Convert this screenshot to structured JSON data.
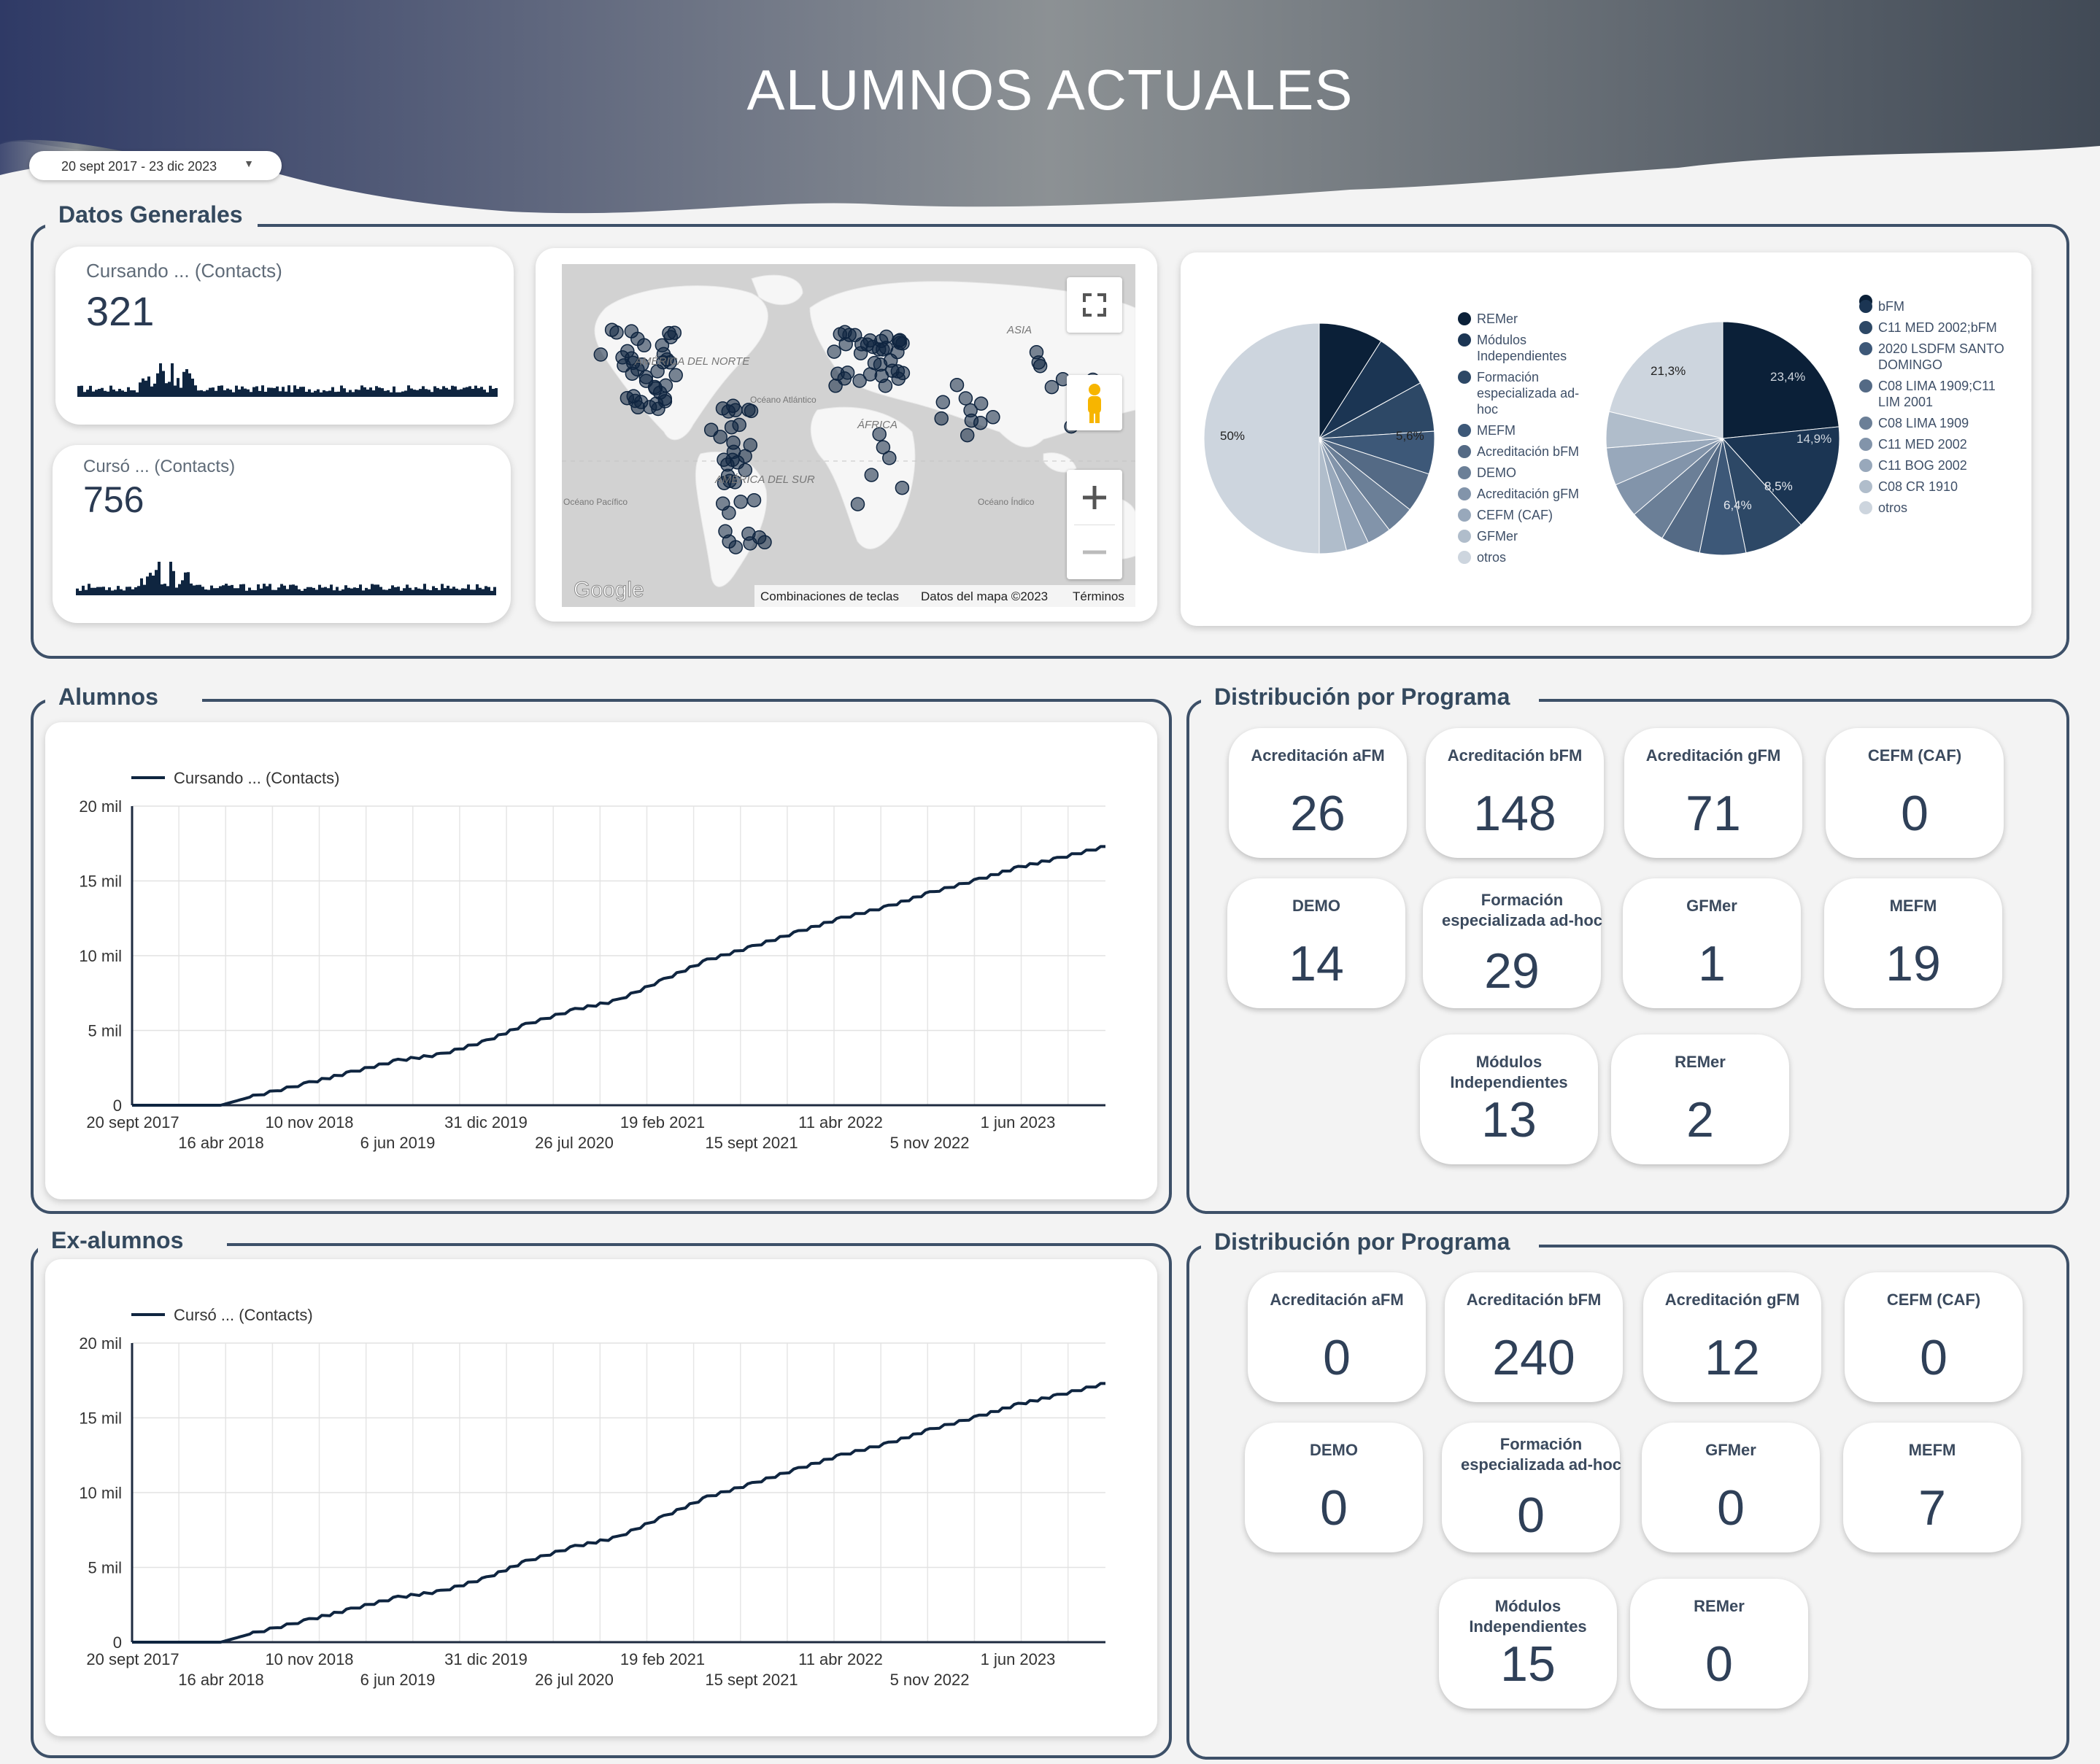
{
  "header": {
    "title": "ALUMNOS ACTUALES"
  },
  "date_range": {
    "label": "20 sept 2017 - 23 dic 2023"
  },
  "datos_generales": {
    "title": "Datos Generales",
    "kpi_cursando": {
      "label": "Cursando ... (Contacts)",
      "value": "321"
    },
    "kpi_curso": {
      "label": "Cursó ... (Contacts)",
      "value": "756"
    },
    "map": {
      "labels": {
        "america_norte": "AMÉRICA DEL NORTE",
        "asia": "ASIA",
        "africa": "ÁFRICA",
        "america_sur": "AMÉRICA DEL SUR",
        "oceano_atlantico": "Océano Atlántico",
        "oceano_pacifico": "Océano Pacífico",
        "oceano_indico": "Océano Índico"
      },
      "google": "Google",
      "footer": {
        "shortcuts": "Combinaciones de teclas",
        "data": "Datos del mapa ©2023",
        "terms": "Términos"
      }
    },
    "pie1": {
      "legend": [
        "REMer",
        "Módulos Independientes",
        "Formación especializada ad-hoc",
        "MEFM",
        "Acreditación bFM",
        "DEMO",
        "Acreditación gFM",
        "CEFM (CAF)",
        "GFMer",
        "otros"
      ],
      "label_big": "50%",
      "label_small": "5,6%"
    },
    "pie2": {
      "legend": [
        "",
        "bFM",
        "C11 MED 2002;bFM",
        "2020 LSDFM SANTO DOMINGO",
        "C08 LIMA 1909;C11 LIM 2001",
        "C08 LIMA 1909",
        "C11 MED 2002",
        "C11 BOG 2002",
        "C08 CR 1910",
        "otros"
      ],
      "labels": [
        "21,3%",
        "23,4%",
        "14,9%",
        "8,5%",
        "6,4%"
      ]
    }
  },
  "alumnos": {
    "title": "Alumnos",
    "chart_data": {
      "type": "line",
      "series": [
        {
          "name": "Cursando ... (Contacts)",
          "x": [
            "2017-09-20",
            "2018-04-16",
            "2018-07-01",
            "2018-11-10",
            "2019-02-15",
            "2019-06-06",
            "2019-09-15",
            "2019-12-31",
            "2020-04-01",
            "2020-07-26",
            "2020-11-01",
            "2021-02-19",
            "2021-06-01",
            "2021-09-15",
            "2022-01-01",
            "2022-04-11",
            "2022-08-01",
            "2022-11-05",
            "2023-03-01",
            "2023-06-01",
            "2023-09-01",
            "2023-12-23"
          ],
          "y": [
            0,
            0,
            600,
            1500,
            2200,
            3000,
            3400,
            4300,
            5400,
            6400,
            7000,
            8400,
            9700,
            10600,
            11600,
            12500,
            13300,
            14200,
            15100,
            15900,
            16500,
            17300
          ]
        }
      ],
      "ylabel": "",
      "xlabel": "",
      "ylim": [
        0,
        20000
      ],
      "yticks": [
        "20 mil",
        "15 mil",
        "10 mil",
        "5 mil",
        "0"
      ],
      "xticks_top": [
        "20 sept 2017",
        "10 nov 2018",
        "31 dic 2019",
        "19 feb 2021",
        "11 abr 2022",
        "1 jun 2023"
      ],
      "xticks_bottom": [
        "16 abr 2018",
        "6 jun 2019",
        "26 jul 2020",
        "15 sept 2021",
        "5 nov 2022"
      ],
      "grid": true,
      "legend": "top-left"
    }
  },
  "exalumnos": {
    "title": "Ex-alumnos",
    "chart_data": {
      "type": "line",
      "series": [
        {
          "name": "Cursó ... (Contacts)",
          "x": [
            "2017-09-20",
            "2018-04-16",
            "2018-07-01",
            "2018-11-10",
            "2019-02-15",
            "2019-06-06",
            "2019-09-15",
            "2019-12-31",
            "2020-04-01",
            "2020-07-26",
            "2020-11-01",
            "2021-02-19",
            "2021-06-01",
            "2021-09-15",
            "2022-01-01",
            "2022-04-11",
            "2022-08-01",
            "2022-11-05",
            "2023-03-01",
            "2023-06-01",
            "2023-09-01",
            "2023-12-23"
          ],
          "y": [
            0,
            0,
            600,
            1500,
            2200,
            3000,
            3400,
            4300,
            5400,
            6400,
            7000,
            8400,
            9700,
            10600,
            11600,
            12500,
            13300,
            14200,
            15100,
            15900,
            16500,
            17300
          ]
        }
      ],
      "ylabel": "",
      "xlabel": "",
      "ylim": [
        0,
        20000
      ],
      "yticks": [
        "20 mil",
        "15 mil",
        "10 mil",
        "5 mil",
        "0"
      ],
      "xticks_top": [
        "20 sept 2017",
        "10 nov 2018",
        "31 dic 2019",
        "19 feb 2021",
        "11 abr 2022",
        "1 jun 2023"
      ],
      "xticks_bottom": [
        "16 abr 2018",
        "6 jun 2019",
        "26 jul 2020",
        "15 sept 2021",
        "5 nov 2022"
      ],
      "grid": true,
      "legend": "top-left"
    }
  },
  "dist1": {
    "title": "Distribución por Programa",
    "cards": [
      {
        "label": "Acreditación aFM",
        "value": "26"
      },
      {
        "label": "Acreditación bFM",
        "value": "148"
      },
      {
        "label": "Acreditación gFM",
        "value": "71"
      },
      {
        "label": "CEFM (CAF)",
        "value": "0"
      },
      {
        "label": "DEMO",
        "value": "14"
      },
      {
        "label": "Formación especializada ad-hoc",
        "value": "29"
      },
      {
        "label": "GFMer",
        "value": "1"
      },
      {
        "label": "MEFM",
        "value": "19"
      },
      {
        "label": "Módulos Independientes",
        "value": "13"
      },
      {
        "label": "REMer",
        "value": "2"
      }
    ]
  },
  "dist2": {
    "title": "Distribución por Programa",
    "cards": [
      {
        "label": "Acreditación aFM",
        "value": "0"
      },
      {
        "label": "Acreditación bFM",
        "value": "240"
      },
      {
        "label": "Acreditación gFM",
        "value": "12"
      },
      {
        "label": "CEFM (CAF)",
        "value": "0"
      },
      {
        "label": "DEMO",
        "value": "0"
      },
      {
        "label": "Formación especializada ad-hoc",
        "value": "0"
      },
      {
        "label": "GFMer",
        "value": "0"
      },
      {
        "label": "MEFM",
        "value": "7"
      },
      {
        "label": "Módulos Independientes",
        "value": "15"
      },
      {
        "label": "REMer",
        "value": "0"
      }
    ]
  },
  "colors": {
    "navy": "#0f2540",
    "accent": "#34495e",
    "border": "#3d5068"
  }
}
